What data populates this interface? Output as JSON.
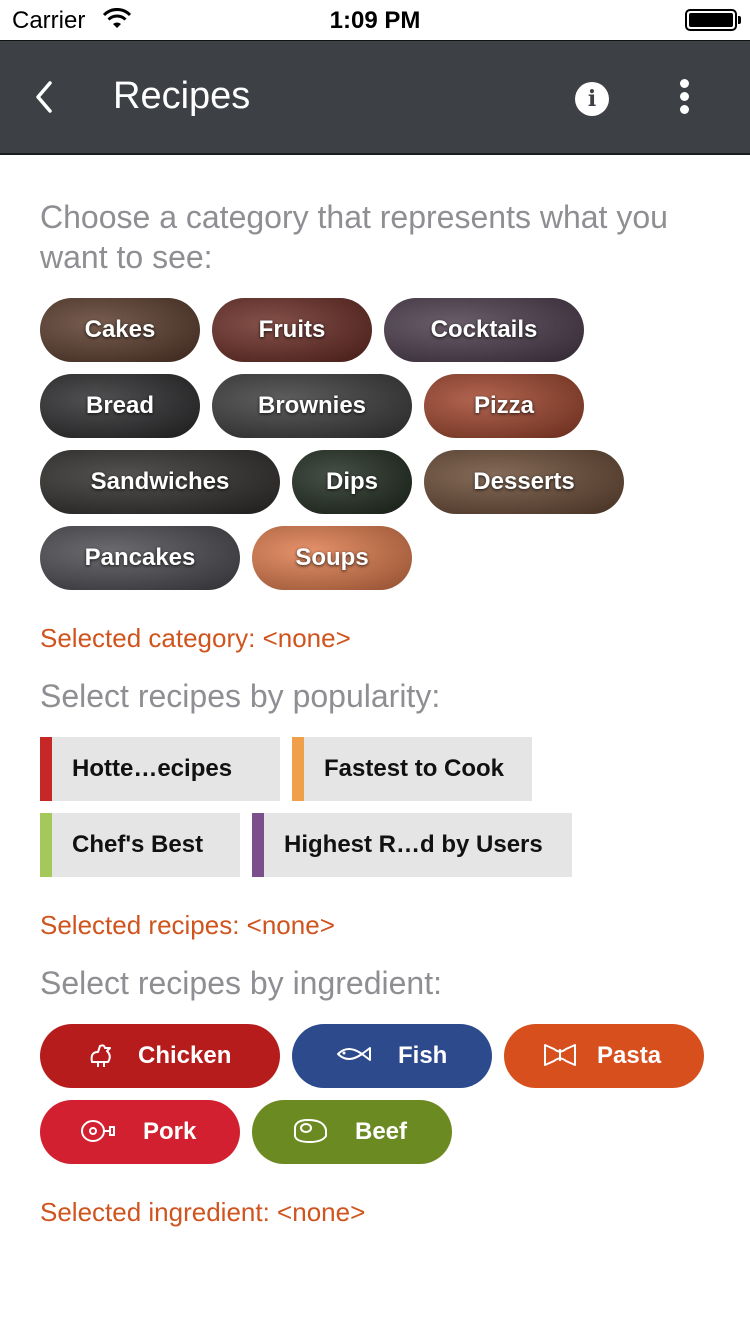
{
  "status_bar": {
    "carrier": "Carrier",
    "time": "1:09 PM"
  },
  "toolbar": {
    "title": "Recipes"
  },
  "prompt": "Choose a category that represents what you want to see:",
  "categories": [
    {
      "label": "Cakes",
      "color": "#5a3a2a"
    },
    {
      "label": "Fruits",
      "color": "#6a2a22"
    },
    {
      "label": "Cocktails",
      "color": "#4a3a4a"
    },
    {
      "label": "Bread",
      "color": "#2a2a2c"
    },
    {
      "label": "Brownies",
      "color": "#3a3a3a"
    },
    {
      "label": "Pizza",
      "color": "#a0432a"
    },
    {
      "label": "Sandwiches",
      "color": "#2e2c2a"
    },
    {
      "label": "Dips",
      "color": "#1e2a1e"
    },
    {
      "label": "Desserts",
      "color": "#6a4a34"
    },
    {
      "label": "Pancakes",
      "color": "#4a4a50"
    },
    {
      "label": "Soups",
      "color": "#e07a4a"
    }
  ],
  "selected_category": "Selected category: <none>",
  "popularity_heading": "Select recipes by popularity:",
  "popularity": [
    {
      "label": "Hotte…ecipes",
      "color": "#c62828"
    },
    {
      "label": "Fastest to Cook",
      "color": "#f0a04b"
    },
    {
      "label": "Chef's Best",
      "color": "#a5c85a"
    },
    {
      "label": "Highest R…d by Users",
      "color": "#7b4e8c"
    }
  ],
  "selected_recipes": "Selected recipes: <none>",
  "ingredient_heading": "Select recipes by ingredient:",
  "ingredients": [
    {
      "label": "Chicken",
      "icon": "chicken-icon",
      "color": "#b71c1c"
    },
    {
      "label": "Fish",
      "icon": "fish-icon",
      "color": "#2c4a8c"
    },
    {
      "label": "Pasta",
      "icon": "pasta-icon",
      "color": "#d84f1e"
    },
    {
      "label": "Pork",
      "icon": "pork-icon",
      "color": "#d32030"
    },
    {
      "label": "Beef",
      "icon": "beef-icon",
      "color": "#6b8a22"
    }
  ],
  "selected_ingredient": "Selected ingredient: <none>"
}
